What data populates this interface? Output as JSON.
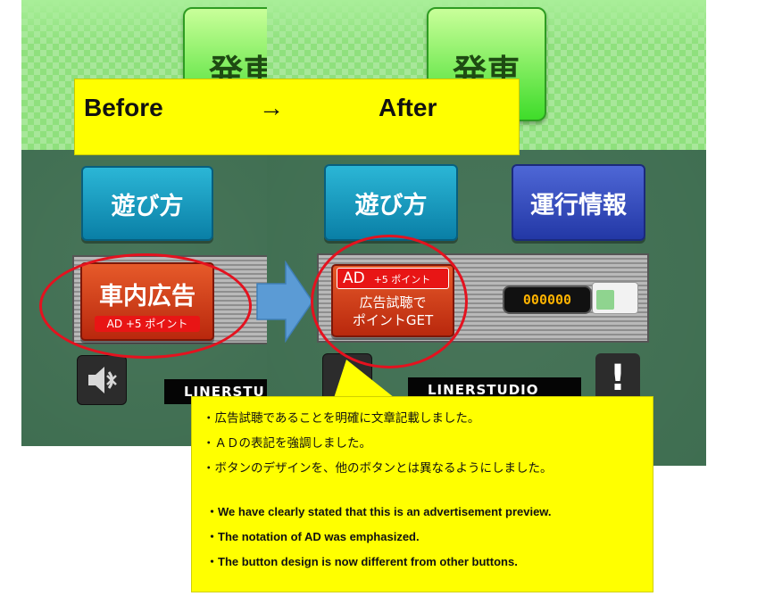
{
  "banner": {
    "before": "Before",
    "arrow": "→",
    "after": "After"
  },
  "game": {
    "start_label": "発車",
    "howto_label": "遊び方",
    "info_label": "運行情報",
    "ad_before": {
      "title": "車内広告",
      "tag": "AD  +5 ポイント"
    },
    "ad_after": {
      "tag_ad": "AD",
      "tag_points": "+5 ポイント",
      "line1": "広告試聴で",
      "line2": "ポイントGET"
    },
    "points_value": "000000",
    "logo_text": "LINERSTUDIO",
    "logo_text_cut": "LINERSTU",
    "alert_symbol": "!"
  },
  "notes": {
    "jp": [
      "・広告試聴であることを明確に文章記載しました。",
      "・ＡＤの表記を強調しました。",
      "・ボタンのデザインを、他のボタンとは異なるようにしました。"
    ],
    "en": [
      "・We have clearly stated that this is an advertisement preview.",
      "・The notation of AD was emphasized.",
      "・The button design is now different from other buttons."
    ]
  },
  "colors": {
    "highlight": "#ffff00",
    "circle": "#e4121f",
    "arrow": "#5b9bd5"
  },
  "icons": [
    "speaker-mute-icon",
    "right-arrow-icon",
    "exclamation-icon",
    "ic-card-icon"
  ]
}
